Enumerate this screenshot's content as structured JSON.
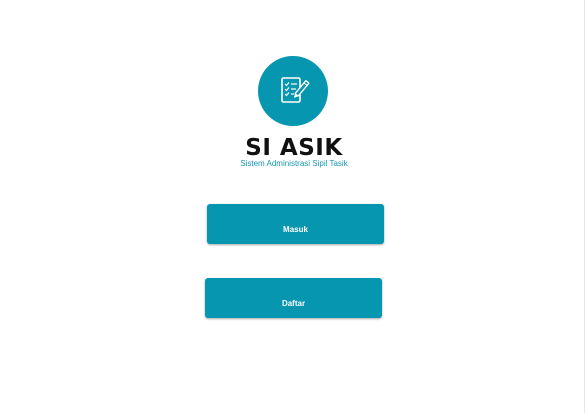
{
  "app": {
    "title": "SI ASIK",
    "subtitle": "Sistem Administrasi Sipil Tasik",
    "logo_icon": "document-edit-icon"
  },
  "actions": {
    "login_label": "Masuk",
    "register_label": "Daftar"
  },
  "colors": {
    "primary": "#0796af",
    "title_text": "#111111",
    "subtitle_text": "#1697b3",
    "button_text": "#ffffff"
  }
}
